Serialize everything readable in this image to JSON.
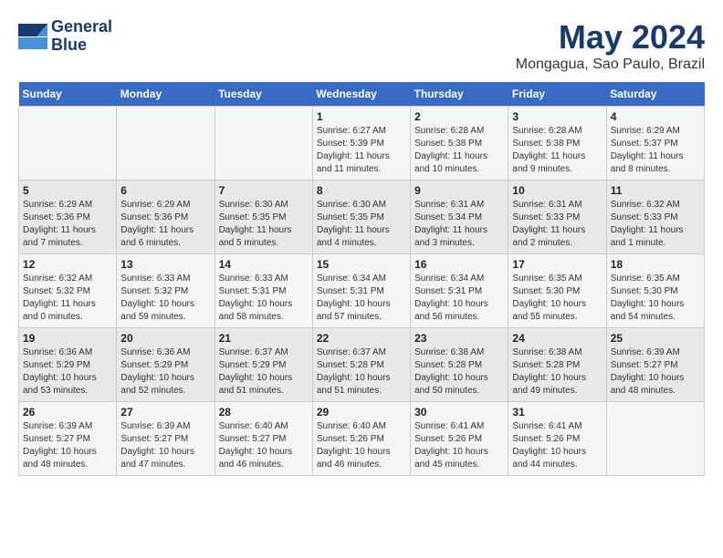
{
  "logo": {
    "line1": "General",
    "line2": "Blue"
  },
  "title": "May 2024",
  "subtitle": "Mongagua, Sao Paulo, Brazil",
  "weekdays": [
    "Sunday",
    "Monday",
    "Tuesday",
    "Wednesday",
    "Thursday",
    "Friday",
    "Saturday"
  ],
  "weeks": [
    [
      {
        "day": "",
        "info": ""
      },
      {
        "day": "",
        "info": ""
      },
      {
        "day": "",
        "info": ""
      },
      {
        "day": "1",
        "info": "Sunrise: 6:27 AM\nSunset: 5:39 PM\nDaylight: 11 hours and 11 minutes."
      },
      {
        "day": "2",
        "info": "Sunrise: 6:28 AM\nSunset: 5:38 PM\nDaylight: 11 hours and 10 minutes."
      },
      {
        "day": "3",
        "info": "Sunrise: 6:28 AM\nSunset: 5:38 PM\nDaylight: 11 hours and 9 minutes."
      },
      {
        "day": "4",
        "info": "Sunrise: 6:29 AM\nSunset: 5:37 PM\nDaylight: 11 hours and 8 minutes."
      }
    ],
    [
      {
        "day": "5",
        "info": "Sunrise: 6:29 AM\nSunset: 5:36 PM\nDaylight: 11 hours and 7 minutes."
      },
      {
        "day": "6",
        "info": "Sunrise: 6:29 AM\nSunset: 5:36 PM\nDaylight: 11 hours and 6 minutes."
      },
      {
        "day": "7",
        "info": "Sunrise: 6:30 AM\nSunset: 5:35 PM\nDaylight: 11 hours and 5 minutes."
      },
      {
        "day": "8",
        "info": "Sunrise: 6:30 AM\nSunset: 5:35 PM\nDaylight: 11 hours and 4 minutes."
      },
      {
        "day": "9",
        "info": "Sunrise: 6:31 AM\nSunset: 5:34 PM\nDaylight: 11 hours and 3 minutes."
      },
      {
        "day": "10",
        "info": "Sunrise: 6:31 AM\nSunset: 5:33 PM\nDaylight: 11 hours and 2 minutes."
      },
      {
        "day": "11",
        "info": "Sunrise: 6:32 AM\nSunset: 5:33 PM\nDaylight: 11 hours and 1 minute."
      }
    ],
    [
      {
        "day": "12",
        "info": "Sunrise: 6:32 AM\nSunset: 5:32 PM\nDaylight: 11 hours and 0 minutes."
      },
      {
        "day": "13",
        "info": "Sunrise: 6:33 AM\nSunset: 5:32 PM\nDaylight: 10 hours and 59 minutes."
      },
      {
        "day": "14",
        "info": "Sunrise: 6:33 AM\nSunset: 5:31 PM\nDaylight: 10 hours and 58 minutes."
      },
      {
        "day": "15",
        "info": "Sunrise: 6:34 AM\nSunset: 5:31 PM\nDaylight: 10 hours and 57 minutes."
      },
      {
        "day": "16",
        "info": "Sunrise: 6:34 AM\nSunset: 5:31 PM\nDaylight: 10 hours and 56 minutes."
      },
      {
        "day": "17",
        "info": "Sunrise: 6:35 AM\nSunset: 5:30 PM\nDaylight: 10 hours and 55 minutes."
      },
      {
        "day": "18",
        "info": "Sunrise: 6:35 AM\nSunset: 5:30 PM\nDaylight: 10 hours and 54 minutes."
      }
    ],
    [
      {
        "day": "19",
        "info": "Sunrise: 6:36 AM\nSunset: 5:29 PM\nDaylight: 10 hours and 53 minutes."
      },
      {
        "day": "20",
        "info": "Sunrise: 6:36 AM\nSunset: 5:29 PM\nDaylight: 10 hours and 52 minutes."
      },
      {
        "day": "21",
        "info": "Sunrise: 6:37 AM\nSunset: 5:29 PM\nDaylight: 10 hours and 51 minutes."
      },
      {
        "day": "22",
        "info": "Sunrise: 6:37 AM\nSunset: 5:28 PM\nDaylight: 10 hours and 51 minutes."
      },
      {
        "day": "23",
        "info": "Sunrise: 6:38 AM\nSunset: 5:28 PM\nDaylight: 10 hours and 50 minutes."
      },
      {
        "day": "24",
        "info": "Sunrise: 6:38 AM\nSunset: 5:28 PM\nDaylight: 10 hours and 49 minutes."
      },
      {
        "day": "25",
        "info": "Sunrise: 6:39 AM\nSunset: 5:27 PM\nDaylight: 10 hours and 48 minutes."
      }
    ],
    [
      {
        "day": "26",
        "info": "Sunrise: 6:39 AM\nSunset: 5:27 PM\nDaylight: 10 hours and 48 minutes."
      },
      {
        "day": "27",
        "info": "Sunrise: 6:39 AM\nSunset: 5:27 PM\nDaylight: 10 hours and 47 minutes."
      },
      {
        "day": "28",
        "info": "Sunrise: 6:40 AM\nSunset: 5:27 PM\nDaylight: 10 hours and 46 minutes."
      },
      {
        "day": "29",
        "info": "Sunrise: 6:40 AM\nSunset: 5:26 PM\nDaylight: 10 hours and 46 minutes."
      },
      {
        "day": "30",
        "info": "Sunrise: 6:41 AM\nSunset: 5:26 PM\nDaylight: 10 hours and 45 minutes."
      },
      {
        "day": "31",
        "info": "Sunrise: 6:41 AM\nSunset: 5:26 PM\nDaylight: 10 hours and 44 minutes."
      },
      {
        "day": "",
        "info": ""
      }
    ]
  ]
}
